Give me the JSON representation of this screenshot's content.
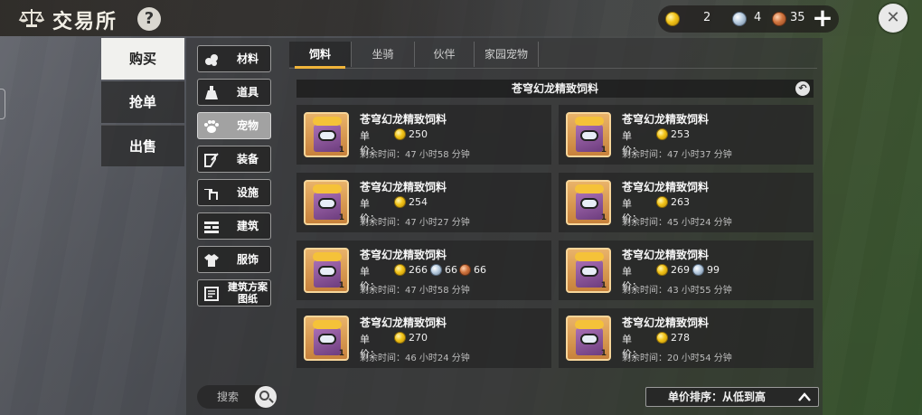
{
  "header": {
    "title": "交易所",
    "help_glyph": "?",
    "close_glyph": "✕",
    "plus_glyph": "+"
  },
  "currency": {
    "gold": "2",
    "silver": "4",
    "copper": "35"
  },
  "main_tabs": [
    {
      "label": "购买",
      "active": true
    },
    {
      "label": "抢单",
      "active": false
    },
    {
      "label": "出售",
      "active": false
    }
  ],
  "categories": [
    {
      "label": "材料",
      "icon": "material-icon",
      "active": false
    },
    {
      "label": "道具",
      "icon": "potion-icon",
      "active": false
    },
    {
      "label": "宠物",
      "icon": "paw-icon",
      "active": true
    },
    {
      "label": "装备",
      "icon": "equipment-icon",
      "active": false
    },
    {
      "label": "设施",
      "icon": "facility-icon",
      "active": false
    },
    {
      "label": "建筑",
      "icon": "building-icon",
      "active": false
    },
    {
      "label": "服饰",
      "icon": "clothing-icon",
      "active": false
    },
    {
      "label": "建筑方案图纸",
      "line1": "建筑方案",
      "line2": "图纸",
      "icon": "blueprint-icon",
      "active": false
    }
  ],
  "search": {
    "placeholder": "搜索"
  },
  "sub_tabs": [
    {
      "label": "饲料",
      "active": true
    },
    {
      "label": "坐骑",
      "active": false
    },
    {
      "label": "伙伴",
      "active": false
    },
    {
      "label": "家园宠物",
      "active": false
    }
  ],
  "item_header": {
    "title": "苍穹幻龙精致饲料"
  },
  "price_label": "单价：",
  "listings": [
    {
      "name": "苍穹幻龙精致饲料",
      "qty": "1",
      "gold": "250",
      "silver": null,
      "copper": null,
      "remaining": "剩余时间：47 小时58 分钟"
    },
    {
      "name": "苍穹幻龙精致饲料",
      "qty": "1",
      "gold": "253",
      "silver": null,
      "copper": null,
      "remaining": "剩余时间：47 小时37 分钟"
    },
    {
      "name": "苍穹幻龙精致饲料",
      "qty": "1",
      "gold": "254",
      "silver": null,
      "copper": null,
      "remaining": "剩余时间：47 小时27 分钟"
    },
    {
      "name": "苍穹幻龙精致饲料",
      "qty": "1",
      "gold": "263",
      "silver": null,
      "copper": null,
      "remaining": "剩余时间：45 小时24 分钟"
    },
    {
      "name": "苍穹幻龙精致饲料",
      "qty": "1",
      "gold": "266",
      "silver": "66",
      "copper": "66",
      "remaining": "剩余时间：47 小时58 分钟"
    },
    {
      "name": "苍穹幻龙精致饲料",
      "qty": "1",
      "gold": "269",
      "silver": "99",
      "copper": null,
      "remaining": "剩余时间：43 小时55 分钟"
    },
    {
      "name": "苍穹幻龙精致饲料",
      "qty": "1",
      "gold": "270",
      "silver": null,
      "copper": null,
      "remaining": "剩余时间：46 小时24 分钟"
    },
    {
      "name": "苍穹幻龙精致饲料",
      "qty": "1",
      "gold": "278",
      "silver": null,
      "copper": null,
      "remaining": "剩余时间：20 小时54 分钟"
    }
  ],
  "sort": {
    "label": "单价排序：从低到高"
  },
  "colors": {
    "accent": "#f0b43a",
    "gold_coin": "#f2c418",
    "silver_coin": "#b9cde0",
    "copper_coin": "#d0743e"
  }
}
